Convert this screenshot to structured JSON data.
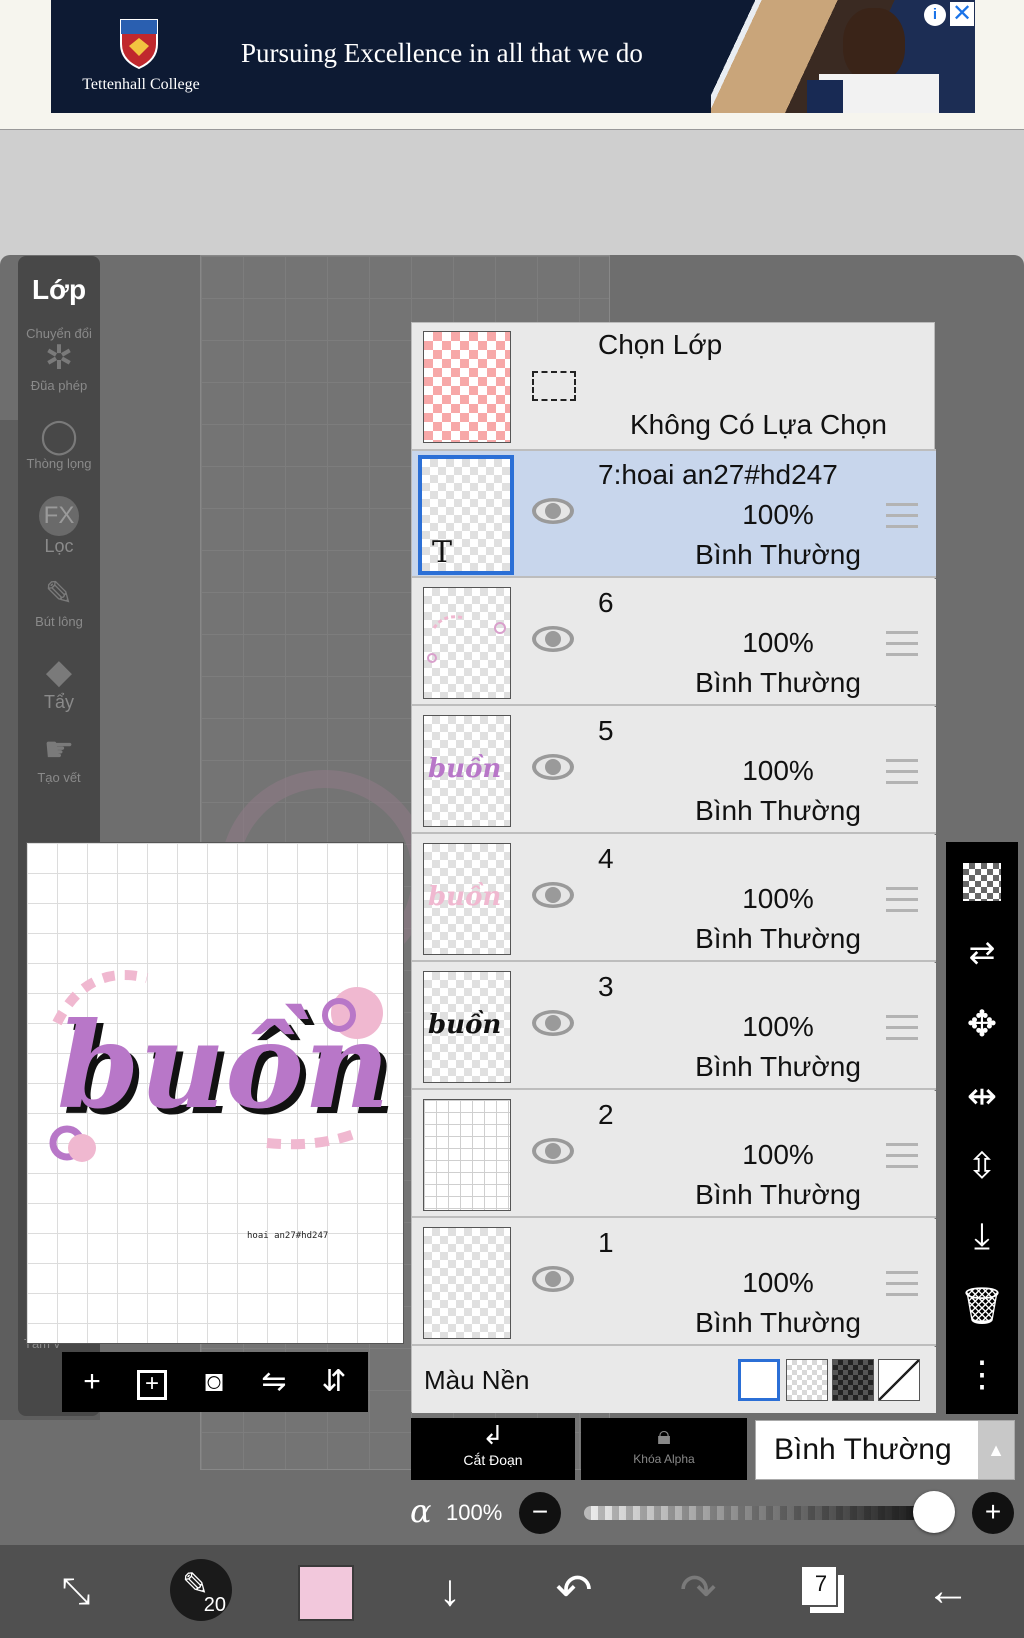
{
  "ad": {
    "college": "Tettenhall College",
    "tagline": "Pursuing Excellence in all that we do",
    "info_icon": "info-icon",
    "close_icon": "close-icon"
  },
  "left_toolbar": {
    "title": "Lớp",
    "tools": [
      {
        "label": "Chuyển đổi",
        "icon": "transform-icon"
      },
      {
        "label": "Đũa phép",
        "icon": "magic-wand-icon"
      },
      {
        "label": "Thòng lọng",
        "icon": "lasso-icon"
      },
      {
        "label": "Lọc",
        "icon": "fx-filter-icon",
        "glyph": "FX"
      },
      {
        "label": "Bút lông",
        "icon": "brush-icon"
      },
      {
        "label": "Tẩy",
        "icon": "eraser-icon"
      },
      {
        "label": "Tạo vết",
        "icon": "smudge-icon"
      },
      {
        "label": "Tấm v",
        "icon": "canvas-icon"
      }
    ]
  },
  "preview": {
    "artwork_text": "buồn",
    "credit": "hoai an27#hd247"
  },
  "layer_panel": {
    "selection": {
      "title": "Chọn Lớp",
      "status": "Không Có Lựa Chọn"
    },
    "layers": [
      {
        "name": "7:hoai an27#hd247",
        "opacity": "100%",
        "mode": "Bình Thường",
        "selected": true,
        "thumb_text": "T"
      },
      {
        "name": "6",
        "opacity": "100%",
        "mode": "Bình Thường",
        "selected": false
      },
      {
        "name": "5",
        "opacity": "100%",
        "mode": "Bình Thường",
        "selected": false
      },
      {
        "name": "4",
        "opacity": "100%",
        "mode": "Bình Thường",
        "selected": false
      },
      {
        "name": "3",
        "opacity": "100%",
        "mode": "Bình Thường",
        "selected": false
      },
      {
        "name": "2",
        "opacity": "100%",
        "mode": "Bình Thường",
        "selected": false
      },
      {
        "name": "1",
        "opacity": "100%",
        "mode": "Bình Thường",
        "selected": false
      }
    ],
    "background": {
      "label": "Màu Nền"
    }
  },
  "blend_bar": {
    "clip_label": "Cắt Đoạn",
    "alpha_lock_label": "Khóa Alpha",
    "blend_mode": "Bình Thường"
  },
  "opacity": {
    "symbol": "α",
    "value": "100%",
    "fraction": 1.0
  },
  "bottom_bar": {
    "brush_size": "20",
    "layer_count": "7",
    "current_color": "#f2c8dc"
  },
  "colors": {
    "selected_row": "#c8d6ec",
    "selected_border": "#2b6fd6",
    "artwork_purple": "#b877c8",
    "artwork_pink": "#f0b8d0"
  }
}
